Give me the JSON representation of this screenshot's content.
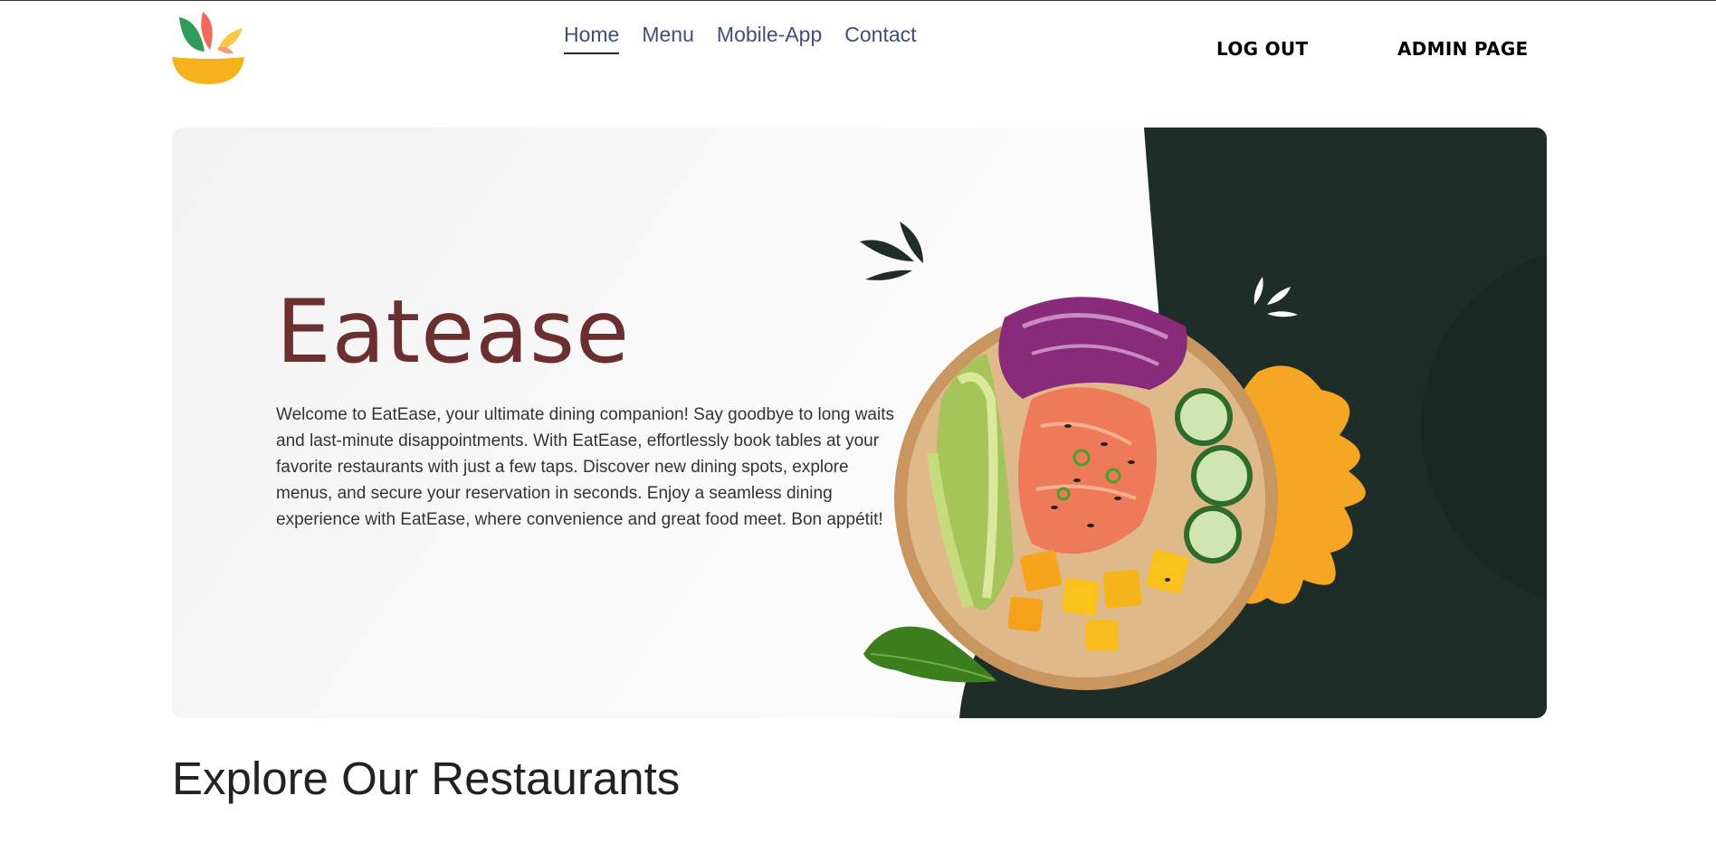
{
  "header": {
    "logo_icon": "bowl-leaves-logo-icon",
    "nav": [
      {
        "label": "Home",
        "active": true
      },
      {
        "label": "Menu",
        "active": false
      },
      {
        "label": "Mobile-App",
        "active": false
      },
      {
        "label": "Contact",
        "active": false
      }
    ],
    "logout_label": "LOG OUT",
    "admin_label": "ADMIN PAGE"
  },
  "hero": {
    "title": "Eatease",
    "description": "Welcome to EatEase, your ultimate dining companion! Say goodbye to long waits and last-minute disappointments. With EatEase, effortlessly book tables at your favorite restaurants with just a few taps. Discover new dining spots, explore menus, and secure your reservation in seconds. Enjoy a seamless dining experience with EatEase, where convenience and great food meet. Bon appétit!",
    "image": "poke-bowl-illustration"
  },
  "section": {
    "title": "Explore Our Restaurants"
  },
  "colors": {
    "nav_link": "#3e4f7a",
    "hero_title": "#6b2f2f",
    "dark_panel": "#1f2d28",
    "accent_orange": "#f5a623"
  }
}
